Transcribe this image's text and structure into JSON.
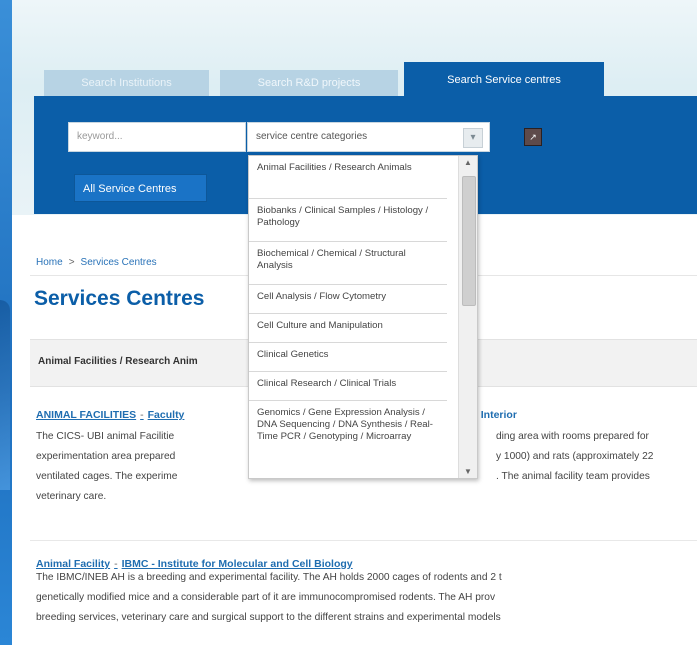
{
  "tabs": [
    {
      "label": "Search Institutions"
    },
    {
      "label": "Search R&D projects"
    },
    {
      "label": "Search Service centres"
    }
  ],
  "search": {
    "keyword_placeholder": "keyword...",
    "category_value": "service centre categories",
    "all_button": "All Service Centres",
    "go_icon": "arrow-icon"
  },
  "dropdown_options": [
    "Animal Facilities / Research Animals",
    "Biobanks / Clinical Samples / Histology / Pathology",
    "Biochemical / Chemical / Structural Analysis",
    "Cell Analysis / Flow Cytometry",
    "Cell Culture and Manipulation",
    "Clinical Genetics",
    "Clinical Research / Clinical Trials",
    "Genomics / Gene Expression Analysis / DNA Sequencing / DNA Synthesis / Real-Time PCR / Genotyping / Microarray"
  ],
  "breadcrumb": {
    "home": "Home",
    "sep": ">",
    "current": "Services Centres"
  },
  "page_title": "Services Centres",
  "category_heading": "Animal Facilities / Research Anim",
  "entries": [
    {
      "title_a": "ANIMAL FACILITIES",
      "dash": "-",
      "title_b": "Faculty",
      "title_c": "a Interior",
      "lines": [
        "The CICS- UBI animal Facilitie",
        "experimentation area prepared",
        "ventilated cages. The experime",
        "veterinary care."
      ],
      "lines_right": [
        "ding area with rooms prepared for",
        "y 1000) and rats (approximately 22",
        ". The animal facility team provides",
        ""
      ]
    },
    {
      "title_a": "Animal Facility",
      "dash": "-",
      "title_b": "IBMC - Institute for Molecular and Cell Biology",
      "lines": [
        "The IBMC/INEB AH is a breeding and experimental facility. The AH holds 2000 cages of rodents and 2 t",
        "genetically modified mice and a considerable part of it are immunocompromised rodents. The AH prov",
        "breeding services, veterinary care and surgical support to the different strains and experimental models"
      ]
    }
  ]
}
